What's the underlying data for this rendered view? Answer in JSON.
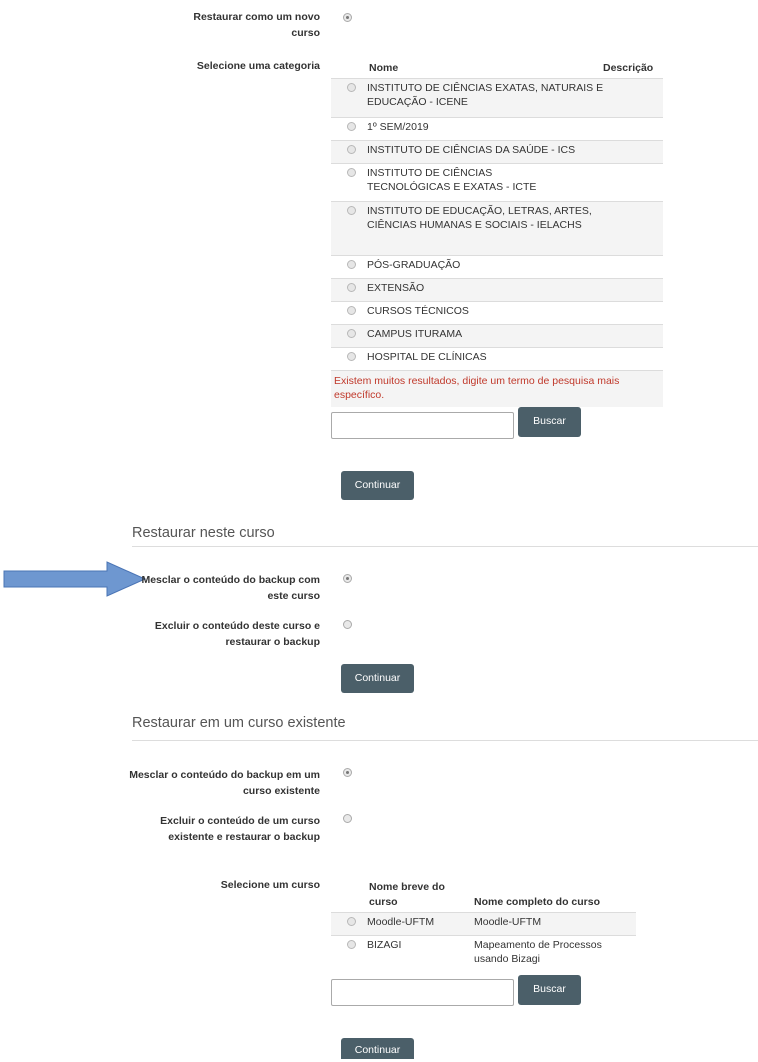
{
  "new_course": {
    "restore_label": "Restaurar como um novo curso",
    "category_label": "Selecione uma categoria",
    "table_headers": {
      "name": "Nome",
      "description": "Descrição"
    },
    "categories": [
      "INSTITUTO DE CIÊNCIAS EXATAS, NATURAIS E EDUCAÇÃO - ICENE",
      "1º SEM/2019",
      "INSTITUTO DE CIÊNCIAS DA SAÚDE - ICS",
      "INSTITUTO DE CIÊNCIAS TECNOLÓGICAS E EXATAS - ICTE",
      "INSTITUTO DE EDUCAÇÃO, LETRAS, ARTES, CIÊNCIAS HUMANAS E SOCIAIS - IELACHS",
      "PÓS-GRADUAÇÃO",
      "EXTENSÃO",
      "CURSOS TÉCNICOS",
      "CAMPUS ITURAMA",
      "HOSPITAL DE CLÍNICAS"
    ],
    "warning": "Existem muitos resultados, digite um termo de pesquisa mais específico.",
    "search_button": "Buscar",
    "continue_button": "Continuar"
  },
  "this_course": {
    "heading": "Restaurar neste curso",
    "merge_label": "Mesclar o conteúdo do backup com este curso",
    "delete_label": "Excluir o conteúdo deste curso e restaurar o backup",
    "continue_button": "Continuar"
  },
  "existing_course": {
    "heading": "Restaurar em um curso existente",
    "merge_label": "Mesclar o conteúdo do backup em um curso existente",
    "delete_label": "Excluir o conteúdo de um curso existente e restaurar o backup",
    "select_label": "Selecione um curso",
    "table_headers": {
      "short": "Nome breve do curso",
      "full": "Nome completo do curso"
    },
    "courses": [
      {
        "short": "Moodle-UFTM",
        "full": "Moodle-UFTM"
      },
      {
        "short": "BIZAGI",
        "full": "Mapeamento de Processos usando Bizagi"
      }
    ],
    "search_button": "Buscar",
    "continue_button": "Continuar"
  },
  "colors": {
    "button": "#4b5f69",
    "warning": "#c0392b",
    "arrow": "#6e97d0"
  }
}
